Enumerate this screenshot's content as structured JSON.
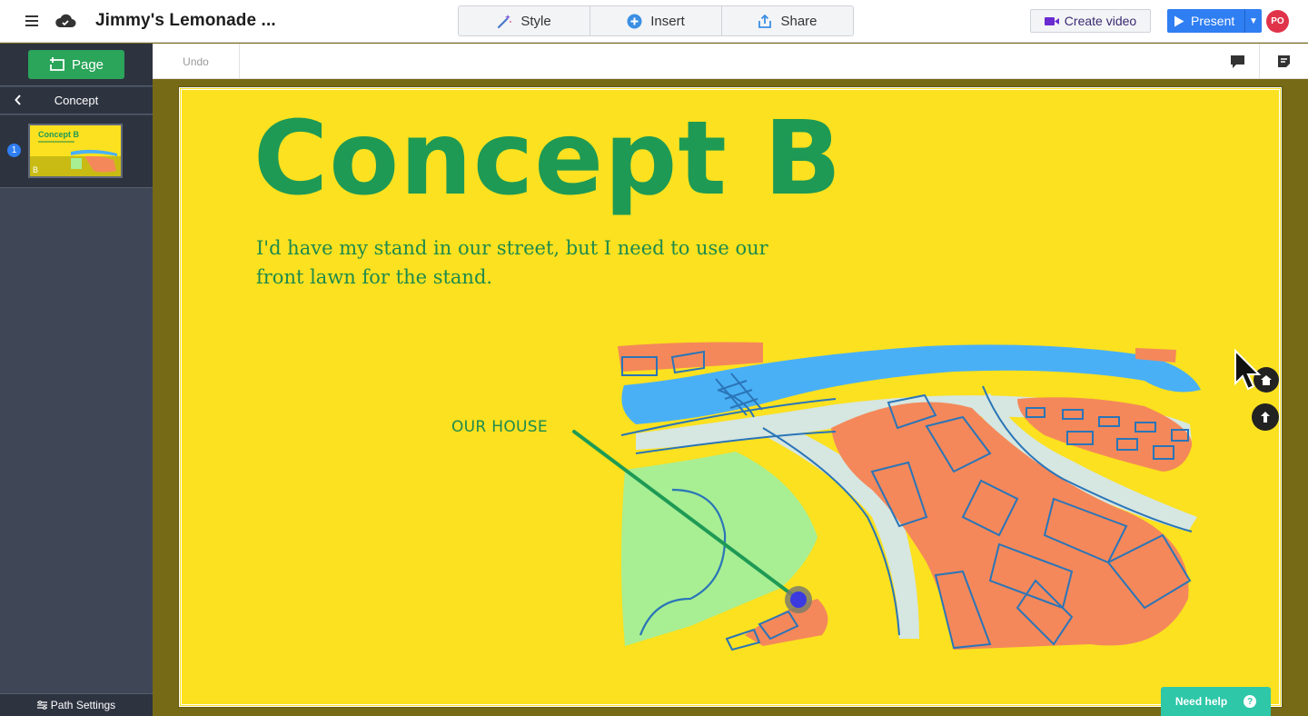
{
  "header": {
    "doc_title": "Jimmy's Lemonade ...",
    "tools": [
      {
        "label": "Style",
        "icon": "magic-wand-icon"
      },
      {
        "label": "Insert",
        "icon": "plus-circle-icon"
      },
      {
        "label": "Share",
        "icon": "share-icon"
      }
    ],
    "create_video_label": "Create video",
    "present_label": "Present",
    "avatar_initials": "PO"
  },
  "sidebar": {
    "page_button_label": "Page",
    "nav_title": "Concept",
    "thumbnail": {
      "number": "1",
      "title": "Concept B",
      "badge": "B"
    },
    "path_settings_label": "Path Settings"
  },
  "subbar": {
    "undo_label": "Undo"
  },
  "slide": {
    "title": "Concept B",
    "body": "I'd have my stand in our street, but I need to use our front lawn for the stand.",
    "house_label": "OUR HOUSE"
  },
  "help": {
    "label": "Need help",
    "icon_text": "?"
  },
  "colors": {
    "slide_bg": "#fbe11f",
    "canvas_bg": "#766a16",
    "title_green": "#1e9a55",
    "river_blue": "#4ab0f5",
    "block_orange": "#f4885a",
    "park_green": "#a8ee93",
    "road_grey": "#d6e6e0",
    "present_blue": "#2f7ef2",
    "page_green": "#2aa55a",
    "help_teal": "#2ec7a8"
  }
}
